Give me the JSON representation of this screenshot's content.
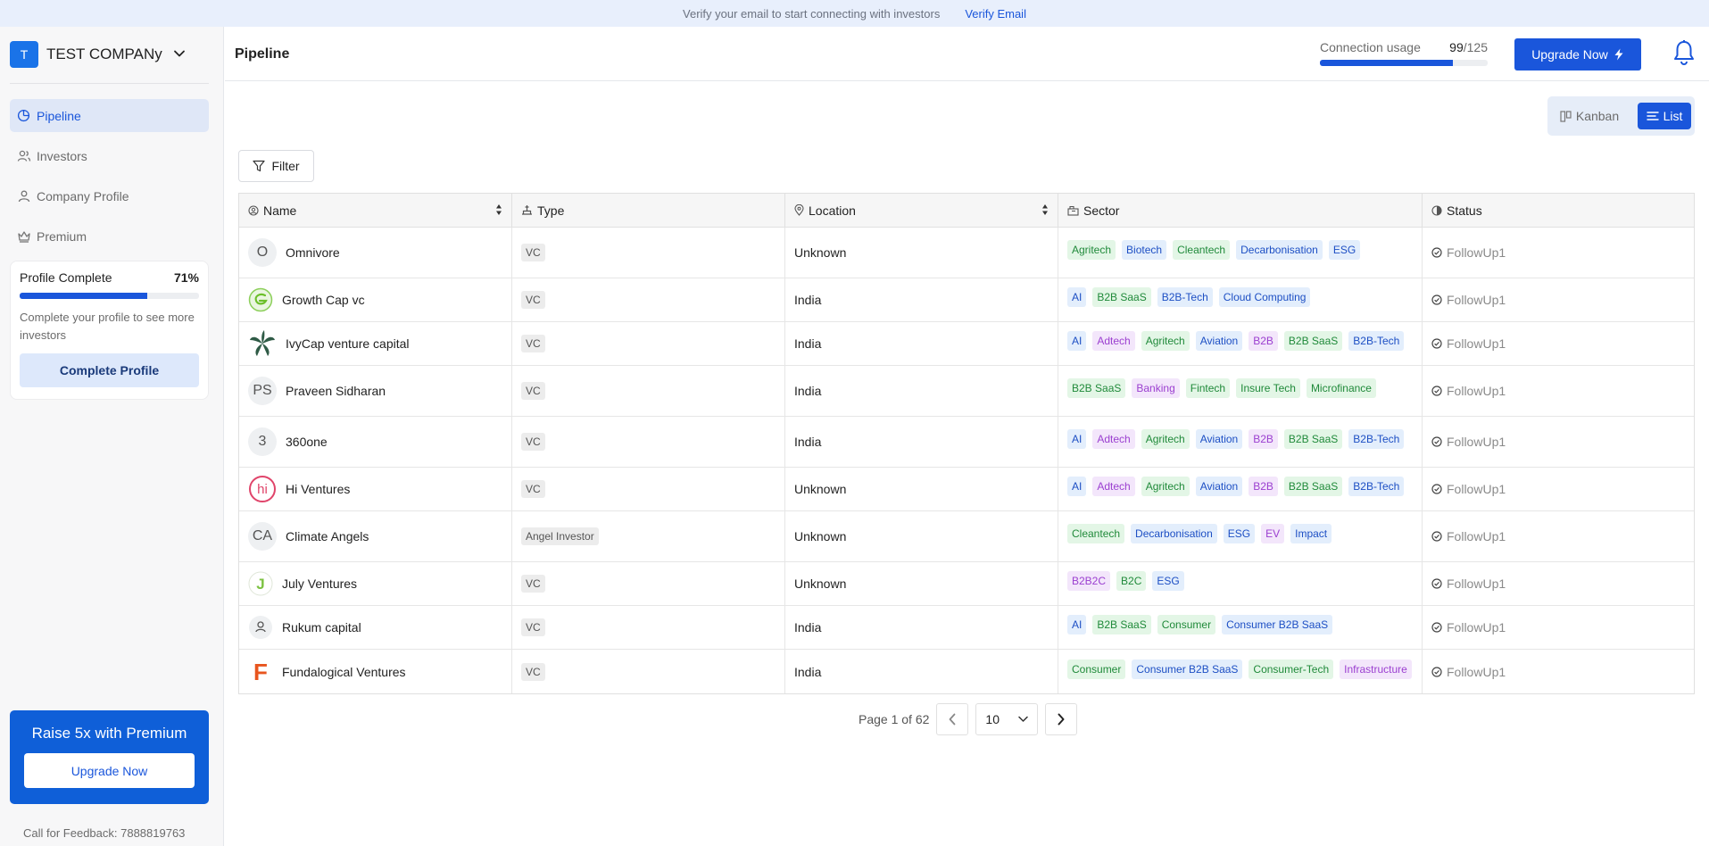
{
  "banner": {
    "message": "Verify your email to start connecting with investors",
    "link": "Verify Email"
  },
  "sidebar": {
    "company_initial": "T",
    "company_name": "TEST COMPANy",
    "nav": [
      {
        "label": "Pipeline",
        "icon": "pie-chart-icon",
        "active": true
      },
      {
        "label": "Investors",
        "icon": "users-icon",
        "active": false
      },
      {
        "label": "Company Profile",
        "icon": "user-icon",
        "active": false
      },
      {
        "label": "Premium",
        "icon": "crown-icon",
        "active": false
      }
    ],
    "profile_card": {
      "title": "Profile Complete",
      "percent_label": "71%",
      "progress": 0.71,
      "description": "Complete your profile to see more investors",
      "button": "Complete Profile"
    },
    "premium": {
      "title": "Raise 5x with Premium",
      "button": "Upgrade Now"
    },
    "feedback": "Call for Feedback: 7888819763"
  },
  "header": {
    "title": "Pipeline",
    "usage_label": "Connection usage",
    "usage_used": "99",
    "usage_total": "/125",
    "usage_fraction": 0.792,
    "upgrade_button": "Upgrade Now"
  },
  "view_toggle": {
    "kanban": "Kanban",
    "list": "List",
    "selected": "List"
  },
  "filter_label": "Filter",
  "table": {
    "columns": [
      "Name",
      "Type",
      "Location",
      "Sector",
      "Status"
    ],
    "rows": [
      {
        "avatar": "O",
        "avatar_style": "initial",
        "name": "Omnivore",
        "type": "VC",
        "location": "Unknown",
        "sectors": [
          [
            "Agritech",
            "green"
          ],
          [
            "Biotech",
            "blue"
          ],
          [
            "Cleantech",
            "green"
          ],
          [
            "Decarbonisation",
            "blue"
          ],
          [
            "ESG",
            "blue"
          ]
        ],
        "status": "FollowUp1"
      },
      {
        "avatar": "",
        "avatar_style": "growthcap",
        "name": "Growth Cap vc",
        "type": "VC",
        "location": "India",
        "sectors": [
          [
            "AI",
            "blue"
          ],
          [
            "B2B SaaS",
            "green"
          ],
          [
            "B2B-Tech",
            "blue"
          ],
          [
            "Cloud Computing",
            "blue"
          ]
        ],
        "status": "FollowUp1"
      },
      {
        "avatar": "",
        "avatar_style": "ivycap",
        "name": "IvyCap venture capital",
        "type": "VC",
        "location": "India",
        "sectors": [
          [
            "AI",
            "blue"
          ],
          [
            "Adtech",
            "purple"
          ],
          [
            "Agritech",
            "green"
          ],
          [
            "Aviation",
            "blue"
          ],
          [
            "B2B",
            "purple"
          ],
          [
            "B2B SaaS",
            "green"
          ],
          [
            "B2B-Tech",
            "blue"
          ]
        ],
        "status": "FollowUp1"
      },
      {
        "avatar": "PS",
        "avatar_style": "initial",
        "name": "Praveen Sidharan",
        "type": "VC",
        "location": "India",
        "sectors": [
          [
            "B2B SaaS",
            "green"
          ],
          [
            "Banking",
            "purple"
          ],
          [
            "Fintech",
            "green"
          ],
          [
            "Insure Tech",
            "green"
          ],
          [
            "Microfinance",
            "green"
          ]
        ],
        "status": "FollowUp1"
      },
      {
        "avatar": "3",
        "avatar_style": "initial",
        "name": "360one",
        "type": "VC",
        "location": "India",
        "sectors": [
          [
            "AI",
            "blue"
          ],
          [
            "Adtech",
            "purple"
          ],
          [
            "Agritech",
            "green"
          ],
          [
            "Aviation",
            "blue"
          ],
          [
            "B2B",
            "purple"
          ],
          [
            "B2B SaaS",
            "green"
          ],
          [
            "B2B-Tech",
            "blue"
          ]
        ],
        "status": "FollowUp1"
      },
      {
        "avatar": "hi",
        "avatar_style": "hi",
        "name": "Hi Ventures",
        "type": "VC",
        "location": "Unknown",
        "sectors": [
          [
            "AI",
            "blue"
          ],
          [
            "Adtech",
            "purple"
          ],
          [
            "Agritech",
            "green"
          ],
          [
            "Aviation",
            "blue"
          ],
          [
            "B2B",
            "purple"
          ],
          [
            "B2B SaaS",
            "green"
          ],
          [
            "B2B-Tech",
            "blue"
          ]
        ],
        "status": "FollowUp1"
      },
      {
        "avatar": "CA",
        "avatar_style": "initial",
        "name": "Climate Angels",
        "type": "Angel Investor",
        "location": "Unknown",
        "sectors": [
          [
            "Cleantech",
            "green"
          ],
          [
            "Decarbonisation",
            "blue"
          ],
          [
            "ESG",
            "blue"
          ],
          [
            "EV",
            "purple"
          ],
          [
            "Impact",
            "blue"
          ]
        ],
        "status": "FollowUp1"
      },
      {
        "avatar": "J",
        "avatar_style": "july",
        "name": "July Ventures",
        "type": "VC",
        "location": "Unknown",
        "sectors": [
          [
            "B2B2C",
            "purple"
          ],
          [
            "B2C",
            "green"
          ],
          [
            "ESG",
            "blue"
          ]
        ],
        "status": "FollowUp1"
      },
      {
        "avatar": "",
        "avatar_style": "person",
        "name": "Rukum capital",
        "type": "VC",
        "location": "India",
        "sectors": [
          [
            "AI",
            "blue"
          ],
          [
            "B2B SaaS",
            "green"
          ],
          [
            "Consumer",
            "green"
          ],
          [
            "Consumer B2B SaaS",
            "blue"
          ]
        ],
        "status": "FollowUp1"
      },
      {
        "avatar": "F",
        "avatar_style": "fundalogical",
        "name": "Fundalogical Ventures",
        "type": "VC",
        "location": "India",
        "sectors": [
          [
            "Consumer",
            "green"
          ],
          [
            "Consumer B2B SaaS",
            "blue"
          ],
          [
            "Consumer-Tech",
            "green"
          ],
          [
            "Infrastructure",
            "purple"
          ]
        ],
        "status": "FollowUp1"
      }
    ]
  },
  "pagination": {
    "label": "Page 1 of 62",
    "page_size": "10"
  },
  "colors": {
    "primary": "#1a56db",
    "tag_green": "#208a3a",
    "tag_blue": "#1d4fc4",
    "tag_purple": "#9b3fd0"
  }
}
